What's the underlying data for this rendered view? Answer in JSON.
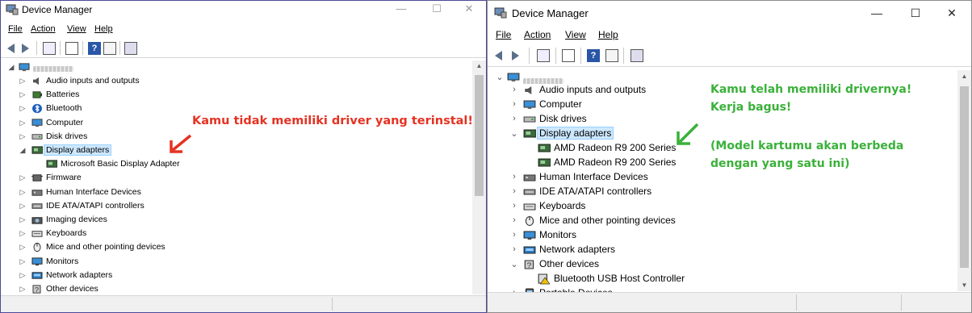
{
  "left_window": {
    "title": "Device Manager",
    "caption": {
      "minimize": "—",
      "maximize": "☐",
      "close": "✕"
    },
    "menu": [
      "File",
      "Action",
      "View",
      "Help"
    ],
    "computer_name_hidden": true,
    "tree": [
      {
        "label": "Audio inputs and outputs",
        "icon": "speaker-icon"
      },
      {
        "label": "Batteries",
        "icon": "battery-icon"
      },
      {
        "label": "Bluetooth",
        "icon": "bluetooth-icon"
      },
      {
        "label": "Computer",
        "icon": "computer-icon"
      },
      {
        "label": "Disk drives",
        "icon": "disk-icon"
      },
      {
        "label": "Display adapters",
        "icon": "display-adapter-icon",
        "expanded": true,
        "selected": true
      },
      {
        "label": "Microsoft Basic Display Adapter",
        "icon": "display-adapter-icon",
        "child": true
      },
      {
        "label": "Firmware",
        "icon": "firmware-icon"
      },
      {
        "label": "Human Interface Devices",
        "icon": "hid-icon"
      },
      {
        "label": "IDE ATA/ATAPI controllers",
        "icon": "ide-icon"
      },
      {
        "label": "Imaging devices",
        "icon": "camera-icon"
      },
      {
        "label": "Keyboards",
        "icon": "keyboard-icon"
      },
      {
        "label": "Mice and other pointing devices",
        "icon": "mouse-icon"
      },
      {
        "label": "Monitors",
        "icon": "monitor-icon"
      },
      {
        "label": "Network adapters",
        "icon": "network-icon"
      },
      {
        "label": "Other devices",
        "icon": "other-devices-icon"
      }
    ],
    "annotation": "Kamu tidak memiliki driver yang terinstal!"
  },
  "right_window": {
    "title": "Device Manager",
    "caption": {
      "minimize": "—",
      "maximize": "☐",
      "close": "✕"
    },
    "menu": [
      "File",
      "Action",
      "View",
      "Help"
    ],
    "computer_name_hidden": true,
    "tree": [
      {
        "label": "Audio inputs and outputs",
        "icon": "speaker-icon"
      },
      {
        "label": "Computer",
        "icon": "computer-icon"
      },
      {
        "label": "Disk drives",
        "icon": "disk-icon"
      },
      {
        "label": "Display adapters",
        "icon": "display-adapter-icon",
        "expanded": true,
        "selected": true
      },
      {
        "label": "AMD Radeon R9 200 Series",
        "icon": "display-adapter-icon",
        "child": true
      },
      {
        "label": "AMD Radeon R9 200 Series",
        "icon": "display-adapter-icon",
        "child": true
      },
      {
        "label": "Human Interface Devices",
        "icon": "hid-icon"
      },
      {
        "label": "IDE ATA/ATAPI controllers",
        "icon": "ide-icon"
      },
      {
        "label": "Keyboards",
        "icon": "keyboard-icon"
      },
      {
        "label": "Mice and other pointing devices",
        "icon": "mouse-icon"
      },
      {
        "label": "Monitors",
        "icon": "monitor-icon"
      },
      {
        "label": "Network adapters",
        "icon": "network-icon"
      },
      {
        "label": "Other devices",
        "icon": "other-devices-icon",
        "expanded": true
      },
      {
        "label": "Bluetooth USB Host Controller",
        "icon": "warning-device-icon",
        "child": true
      },
      {
        "label": "Portable Devices",
        "icon": "portable-icon"
      }
    ],
    "annotation_lines": [
      "Kamu telah memiliki drivernya!",
      "Kerja bagus!"
    ],
    "note_lines": [
      "(Model kartumu akan berbeda",
      "dengan yang satu ini)"
    ]
  },
  "colors": {
    "annotation_red": "#e53222",
    "annotation_green": "#3ab13a",
    "selection": "#cce8ff"
  }
}
